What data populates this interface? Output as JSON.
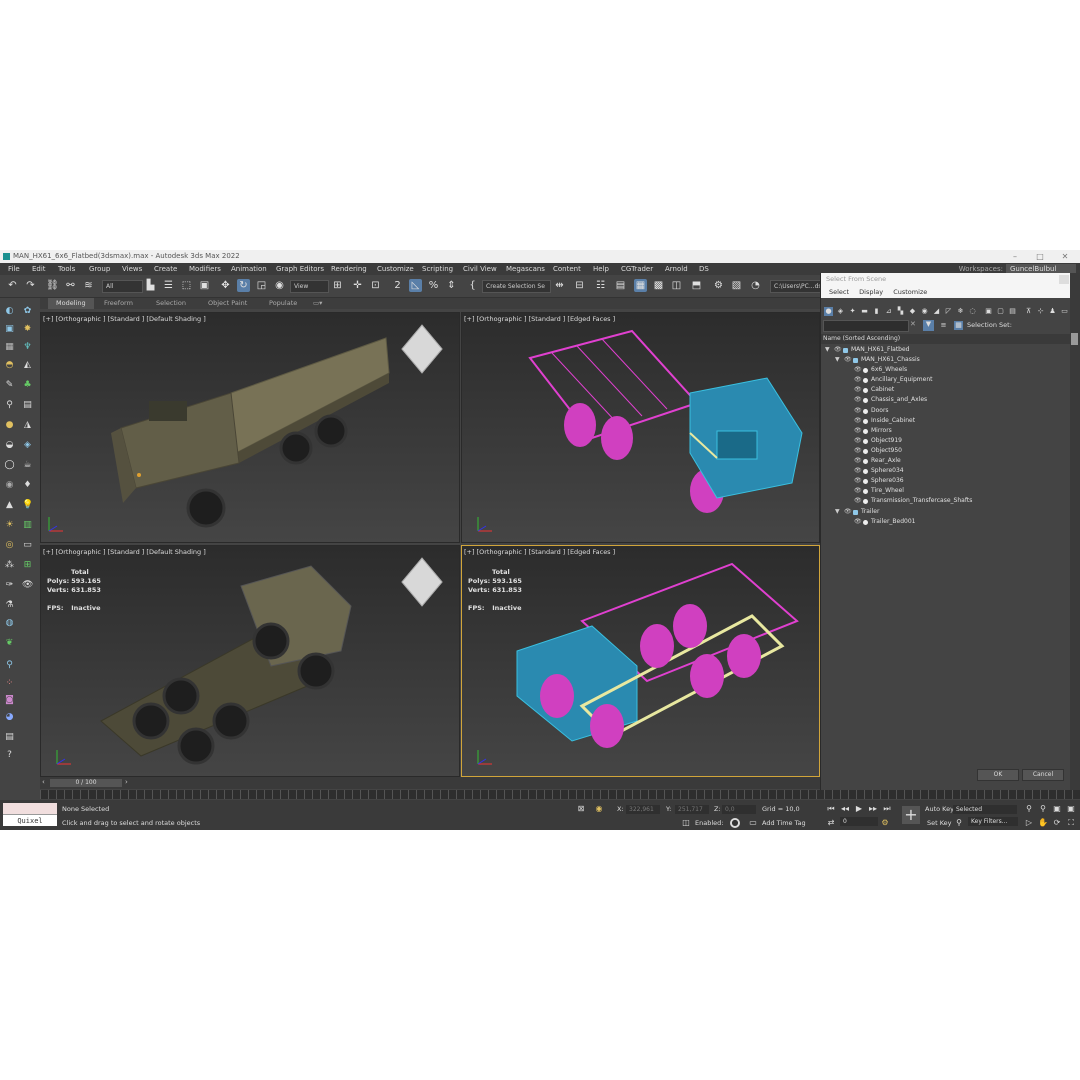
{
  "window": {
    "title": "MAN_HX61_6x6_Flatbed(3dsmax).max - Autodesk 3ds Max 2022",
    "controls": [
      "–",
      "□",
      "✕"
    ]
  },
  "menu": {
    "items": [
      "File",
      "Edit",
      "Tools",
      "Group",
      "Views",
      "Create",
      "Modifiers",
      "Animation",
      "Graph Editors",
      "Rendering",
      "Customize",
      "Scripting",
      "Civil View",
      "Megascans",
      "Content",
      "Help",
      "CGTrader",
      "Arnold",
      "DS"
    ],
    "workspaces_label": "Workspaces:",
    "workspace": "GuncelBulbul"
  },
  "toolbar": {
    "filter_value": "All",
    "view_value": "View",
    "selection_set": "Create Selection Se",
    "path_value": "C:\\Users\\PC...ds"
  },
  "ribbon": {
    "tabs": [
      "Modeling",
      "Freeform",
      "Selection",
      "Object Paint",
      "Populate"
    ]
  },
  "viewports": {
    "top_left": {
      "label": "[+] [Orthographic ] [Standard ] [Default Shading ]"
    },
    "top_right": {
      "label": "[+] [Orthographic ] [Standard ] [Edged Faces ]"
    },
    "bottom_left": {
      "label": "[+] [Orthographic ] [Standard ] [Default Shading ]",
      "stats_total": "Total",
      "polys_label": "Polys:",
      "polys": "593.165",
      "verts_label": "Verts:",
      "verts": "631.853",
      "fps_label": "FPS:",
      "fps": "Inactive"
    },
    "bottom_right": {
      "label": "[+] [Orthographic ] [Standard ] [Edged Faces ]",
      "stats_total": "Total",
      "polys_label": "Polys:",
      "polys": "593.165",
      "verts_label": "Verts:",
      "verts": "631.853",
      "fps_label": "FPS:",
      "fps": "Inactive"
    }
  },
  "timeline": {
    "frame": "0 / 100"
  },
  "status": {
    "quixel": "Quixel Bridge",
    "selection": "None Selected",
    "hint": "Click and drag to select and rotate objects",
    "x_label": "X:",
    "x": "322,961",
    "y_label": "Y:",
    "y": "251,717",
    "z_label": "Z:",
    "z": "0,0",
    "grid": "Grid = 10,0",
    "enabled_label": "Enabled:",
    "add_time_tag": "Add Time Tag",
    "auto_key": "Auto Key",
    "set_key": "Set Key",
    "selected": "Selected",
    "key_filters": "Key Filters...",
    "frame_value": "0"
  },
  "scene_panel": {
    "title": "Select From Scene",
    "menu": [
      "Select",
      "Display",
      "Customize"
    ],
    "selection_set_label": "Selection Set:",
    "column_header": "Name (Sorted Ascending)",
    "tree": [
      {
        "name": "MAN_HX61_Flatbed",
        "level": 0,
        "expanded": true
      },
      {
        "name": "MAN_HX61_Chassis",
        "level": 1,
        "expanded": true
      },
      {
        "name": "6x6_Wheels",
        "level": 2
      },
      {
        "name": "Ancillary_Equipment",
        "level": 2
      },
      {
        "name": "Cabinet",
        "level": 2
      },
      {
        "name": "Chassis_and_Axles",
        "level": 2
      },
      {
        "name": "Doors",
        "level": 2
      },
      {
        "name": "Inside_Cabinet",
        "level": 2
      },
      {
        "name": "Mirrors",
        "level": 2
      },
      {
        "name": "Object919",
        "level": 2
      },
      {
        "name": "Object950",
        "level": 2
      },
      {
        "name": "Rear_Axle",
        "level": 2
      },
      {
        "name": "Sphere034",
        "level": 2
      },
      {
        "name": "Sphere036",
        "level": 2
      },
      {
        "name": "Tire_Wheel",
        "level": 2
      },
      {
        "name": "Transmission_Transfercase_Shafts",
        "level": 2
      },
      {
        "name": "Trailer",
        "level": 1,
        "expanded": true
      },
      {
        "name": "Trailer_Bed001",
        "level": 2
      }
    ],
    "ok": "OK",
    "cancel": "Cancel"
  },
  "colors": {
    "accent": "#5a7fa8",
    "active_viewport": "#d1a53a",
    "wire_magenta": "#e040d0",
    "wire_cyan": "#2aa8c8",
    "wire_yellow": "#e8e8a0",
    "truck_tan": "#6e6a55"
  }
}
